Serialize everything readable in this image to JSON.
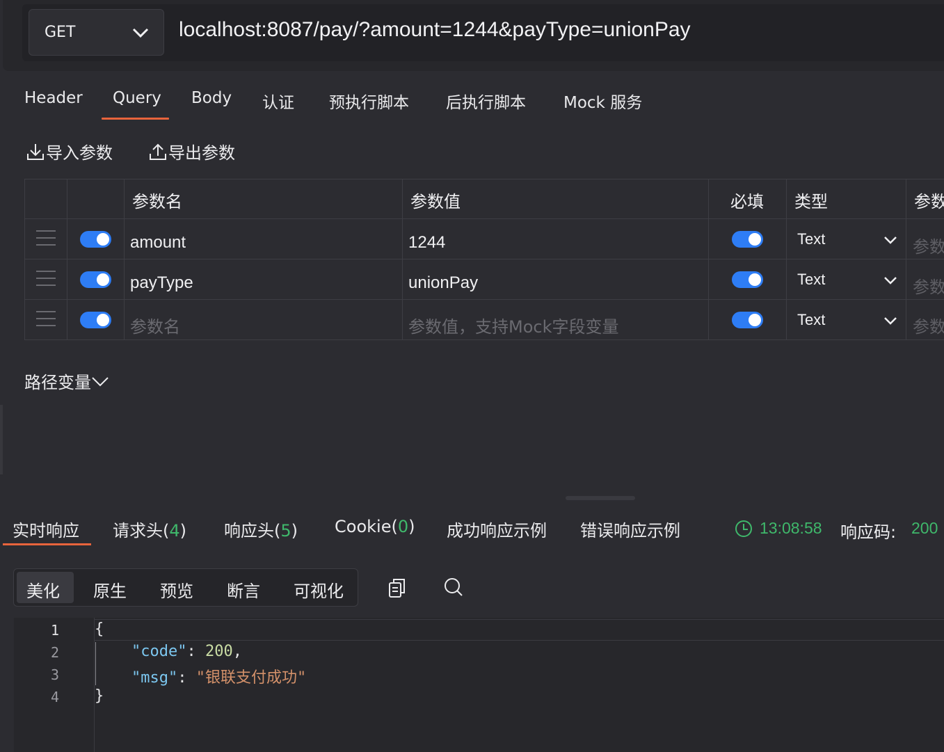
{
  "request": {
    "method": "GET",
    "url": "localhost:8087/pay/?amount=1244&payType=unionPay"
  },
  "tabs": [
    "Header",
    "Query",
    "Body",
    "认证",
    "预执行脚本",
    "后执行脚本",
    "Mock 服务"
  ],
  "active_tab": "Query",
  "actions": {
    "import_label": "导入参数",
    "export_label": "导出参数"
  },
  "params_table": {
    "headers": {
      "name": "参数名",
      "value": "参数值",
      "required": "必填",
      "type": "类型",
      "desc": "参数"
    },
    "rows": [
      {
        "name": "amount",
        "value": "1244",
        "enabled": true,
        "required": true,
        "type": "Text",
        "desc_placeholder": "参数"
      },
      {
        "name": "payType",
        "value": "unionPay",
        "enabled": true,
        "required": true,
        "type": "Text",
        "desc_placeholder": "参数"
      }
    ],
    "new_row": {
      "name_placeholder": "参数名",
      "value_placeholder": "参数值，支持Mock字段变量",
      "enabled": true,
      "required": true,
      "type": "Text",
      "desc_placeholder": "参数"
    }
  },
  "path_variables_label": "路径变量",
  "response": {
    "tabs": {
      "realtime": "实时响应",
      "req_headers": "请求头(",
      "req_headers_count": "4",
      "resp_headers": "响应头(",
      "resp_headers_count": "5",
      "cookie": "Cookie(",
      "cookie_count": "0",
      "close_paren": ")",
      "success_example": "成功响应示例",
      "error_example": "错误响应示例"
    },
    "time": "13:08:58",
    "status_label": "响应码:",
    "status_code": "200",
    "view_modes": [
      "美化",
      "原生",
      "预览",
      "断言",
      "可视化"
    ],
    "active_view": "美化",
    "line_numbers": [
      "1",
      "2",
      "3",
      "4"
    ],
    "body": {
      "open_brace": "{",
      "code_key": "\"code\"",
      "code_value": "200",
      "msg_key": "\"msg\"",
      "msg_value": "\"银联支付成功\"",
      "close_brace": "}"
    }
  },
  "colors": {
    "accent_underline": "#e8643c",
    "toggle_on": "#2e7df5",
    "success_green": "#3fb86b",
    "background": "#2c2c31"
  }
}
